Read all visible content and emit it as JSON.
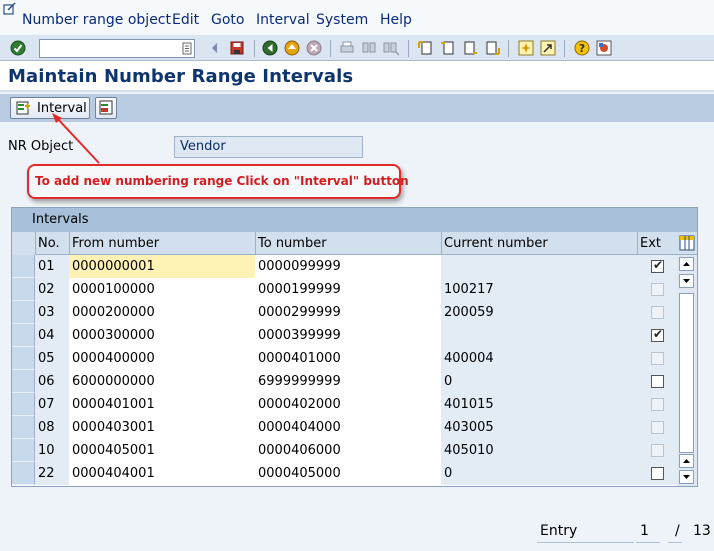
{
  "menubar": {
    "items": [
      {
        "label": "Number range object"
      },
      {
        "label": "Edit"
      },
      {
        "label": "Goto"
      },
      {
        "label": "Interval"
      },
      {
        "label": "System"
      },
      {
        "label": "Help"
      }
    ]
  },
  "toolbar": {
    "command_value": "",
    "icons": [
      "enter-icon",
      "command-history-icon",
      "back-arrow-icon",
      "save-icon",
      "back-icon",
      "exit-icon",
      "cancel-icon",
      "print-icon",
      "find-icon",
      "find-next-icon",
      "first-page-icon",
      "previous-page-icon",
      "next-page-icon",
      "last-page-icon",
      "create-session-icon",
      "shortcut-icon",
      "help-icon",
      "customize-layout-icon"
    ]
  },
  "title": "Maintain Number Range Intervals",
  "app_toolbar": {
    "interval_label": "Interval"
  },
  "nr_object": {
    "label": "NR Object",
    "value": "Vendor"
  },
  "callout": {
    "text": "To add new numbering range Click on \"Interval\" button"
  },
  "table": {
    "caption": "Intervals",
    "columns": [
      "No.",
      "From number",
      "To number",
      "Current number",
      "Ext"
    ],
    "rows": [
      {
        "no": "01",
        "from": "0000000001",
        "to": "0000099999",
        "current": "",
        "ext": "checked"
      },
      {
        "no": "02",
        "from": "0000100000",
        "to": "0000199999",
        "current": "100217",
        "ext": "disabled"
      },
      {
        "no": "03",
        "from": "0000200000",
        "to": "0000299999",
        "current": "200059",
        "ext": "disabled"
      },
      {
        "no": "04",
        "from": "0000300000",
        "to": "0000399999",
        "current": "",
        "ext": "checked"
      },
      {
        "no": "05",
        "from": "0000400000",
        "to": "0000401000",
        "current": "400004",
        "ext": "disabled"
      },
      {
        "no": "06",
        "from": "6000000000",
        "to": "6999999999",
        "current": "0",
        "ext": "unchecked"
      },
      {
        "no": "07",
        "from": "0000401001",
        "to": "0000402000",
        "current": "401015",
        "ext": "disabled"
      },
      {
        "no": "08",
        "from": "0000403001",
        "to": "0000404000",
        "current": "403005",
        "ext": "disabled"
      },
      {
        "no": "10",
        "from": "0000405001",
        "to": "0000406000",
        "current": "405010",
        "ext": "disabled"
      },
      {
        "no": "22",
        "from": "0000404001",
        "to": "0000405000",
        "current": "0",
        "ext": "unchecked"
      }
    ]
  },
  "footer": {
    "entry_label": "Entry",
    "entry_current": "1",
    "entry_separator": "/",
    "entry_total": "13"
  },
  "colors": {
    "title": "#0e3570",
    "callout_border": "#e32a2a",
    "callout_text": "#d41e1e",
    "menu_text": "#0a2a7a"
  }
}
